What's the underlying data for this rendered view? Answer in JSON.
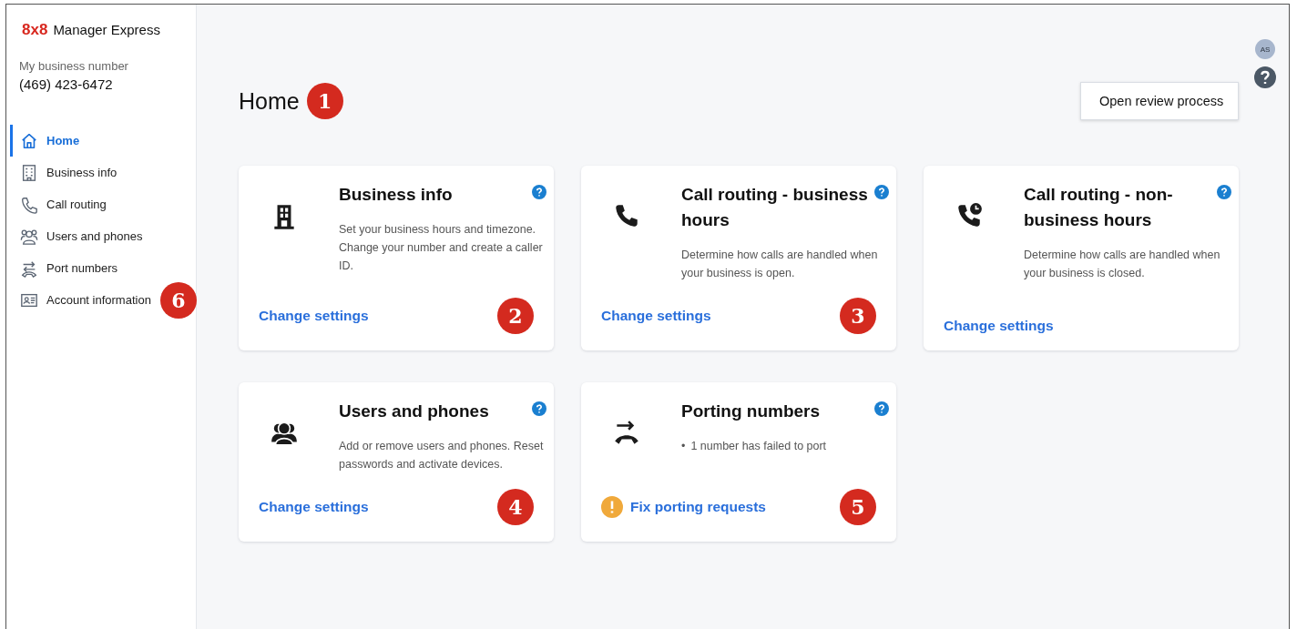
{
  "brand": {
    "logo": "8x8",
    "product": "Manager Express"
  },
  "business_number": {
    "label": "My business number",
    "value": "(469) 423-6472"
  },
  "nav": [
    {
      "label": "Home",
      "selected": true
    },
    {
      "label": "Business info",
      "selected": false
    },
    {
      "label": "Call routing",
      "selected": false
    },
    {
      "label": "Users and phones",
      "selected": false
    },
    {
      "label": "Port numbers",
      "selected": false
    },
    {
      "label": "Account information",
      "selected": false,
      "callout": "6"
    }
  ],
  "page": {
    "title": "Home",
    "callout": "1",
    "button": "Open review process"
  },
  "user": {
    "initials": "AS"
  },
  "cards": [
    {
      "title": "Business info",
      "kind": "description",
      "text": "Set your business hours and timezone. Change your number and create a caller ID.",
      "link": "Change settings",
      "warning": false,
      "callout": "2"
    },
    {
      "title": "Call routing - business hours",
      "kind": "description",
      "text": "Determine how calls are handled when your business is open.",
      "link": "Change settings",
      "warning": false,
      "callout": "3"
    },
    {
      "title": "Call routing - non-business hours",
      "kind": "description",
      "text": "Determine how calls are handled when your business is closed.",
      "link": "Change settings",
      "warning": false
    },
    {
      "title": "Users and phones",
      "kind": "description",
      "text": "Add or remove users and phones. Reset passwords and activate devices.",
      "link": "Change settings",
      "warning": false,
      "callout": "4"
    },
    {
      "title": "Porting numbers",
      "kind": "bullets",
      "bullet": "•",
      "items": [
        "1 number has failed to port"
      ],
      "link": "Fix porting requests",
      "warning": true,
      "callout": "5"
    }
  ]
}
